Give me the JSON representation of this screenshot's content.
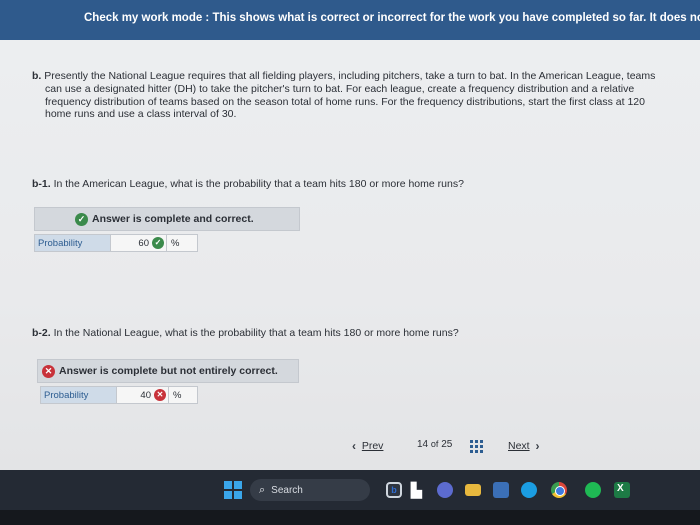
{
  "banner": {
    "text": "Check my work mode : This shows what is correct or incorrect for the work you have completed so far. It does not indic"
  },
  "question_b": {
    "label": "b.",
    "line1": " Presently the National League requires that all fielding players, including pitchers, take a turn to bat. In the American League, teams",
    "line2": "can use a designated hitter (DH) to take the pitcher's turn to bat. For each league, create a frequency distribution and a relative",
    "line3": "frequency distribution of teams based on the season total of home runs. For the frequency distributions, start the first class at 120",
    "line4": "home runs and use a class interval of 30."
  },
  "part1": {
    "label": "b-1.",
    "text": " In the American League, what is the probability that a team hits 180 or more home runs?",
    "status": "Answer is complete and correct.",
    "field_label": "Probability",
    "value": "60",
    "unit": "%",
    "status_icon": "check-circle-icon",
    "status_color": "#3b8a4b"
  },
  "part2": {
    "label": "b-2.",
    "text": " In the National League, what is the probability that a team hits 180 or more home runs?",
    "status": "Answer is complete but not entirely correct.",
    "field_label": "Probability",
    "value": "40",
    "unit": "%",
    "status_icon": "x-circle-icon",
    "status_color": "#c8323a"
  },
  "pager": {
    "prev": "Prev",
    "current": "14",
    "of": "of",
    "total": "25",
    "next": "Next"
  },
  "taskbar": {
    "search_label": "Search"
  }
}
